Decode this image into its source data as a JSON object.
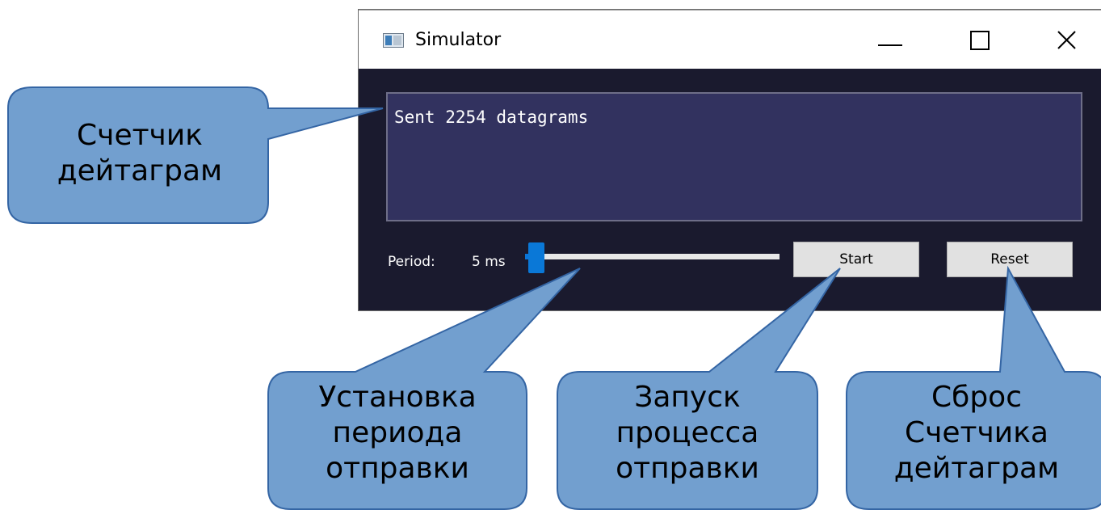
{
  "window": {
    "title": "Simulator",
    "controls": [
      "minimize",
      "maximize",
      "close"
    ]
  },
  "output": {
    "text": "Sent 2254 datagrams"
  },
  "controls": {
    "period_label": "Period:",
    "period_value": "5 ms",
    "slider_level": 0.0,
    "start_label": "Start",
    "reset_label": "Reset"
  },
  "callouts": {
    "counter": [
      "Счетчик",
      "дейтаграм"
    ],
    "period": [
      "Установка",
      "периода",
      "отправки"
    ],
    "start": [
      "Запуск",
      "процесса",
      "отправки"
    ],
    "reset": [
      "Сброс",
      "Счетчика",
      "дейтаграм"
    ]
  },
  "colors": {
    "callout_fill": "#729fcf",
    "callout_stroke": "#3465a4",
    "window_bg": "#1a1a2e",
    "output_bg": "#32325f",
    "accent": "#0a78d7"
  }
}
